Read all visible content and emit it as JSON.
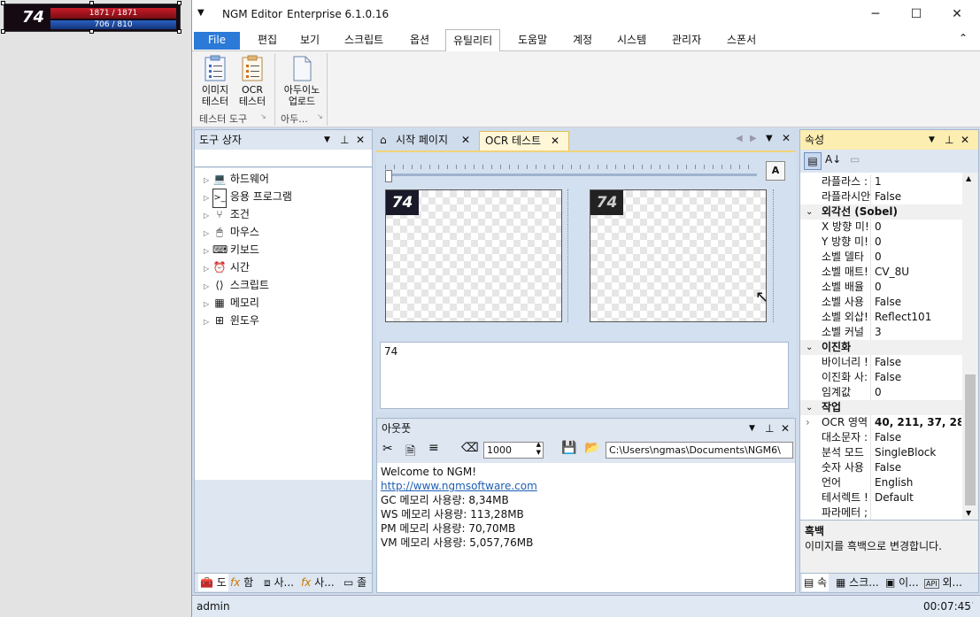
{
  "capture": {
    "level": "74",
    "hp": "1871 / 1871",
    "mp": "706 / 810"
  },
  "window": {
    "app_name": "NGM Editor",
    "edition": "Enterprise 6.1.0.16",
    "menu_glyph": "▼",
    "minimize": "─",
    "maximize": "☐",
    "close": "✕"
  },
  "menu": {
    "file": "File",
    "items": [
      "편집",
      "보기",
      "스크립트",
      "옵션",
      "유틸리티",
      "도움말",
      "계정",
      "시스템",
      "관리자",
      "스폰서"
    ],
    "active_index": 4,
    "collapse": "⌃"
  },
  "ribbon": {
    "buttons": [
      {
        "line1": "이미지",
        "line2": "테스터"
      },
      {
        "line1": "OCR",
        "line2": "테스터"
      },
      {
        "line1": "아두이노",
        "line2": "업로드"
      }
    ],
    "groups": [
      "테스터 도구",
      "아두..."
    ]
  },
  "toolbox": {
    "title": "도구 상자",
    "items": [
      "하드웨어",
      "응용 프로그램",
      "조건",
      "마우스",
      "키보드",
      "시간",
      "스크립트",
      "메모리",
      "윈도우"
    ],
    "bottom_tabs": [
      "도",
      "함",
      "사...",
      "사...",
      "졸"
    ]
  },
  "editor": {
    "tabs": [
      "시작 페이지",
      "OCR 테스트"
    ],
    "active_tab": 1,
    "image_level": "74",
    "ocr_result": "74"
  },
  "output": {
    "title": "아웃풋",
    "line_count": "1000",
    "path": "C:\\Users\\ngmas\\Documents\\NGM6\\",
    "lines": [
      "Welcome to NGM!",
      "http://www.ngmsoftware.com",
      "GC 메모리 사용량: 8,34MB",
      "WS 메모리 사용량: 113,28MB",
      "PM 메모리 사용량: 70,70MB",
      "VM 메모리 사용량: 5,057,76MB"
    ]
  },
  "properties": {
    "title": "속성",
    "rows": [
      {
        "type": "prop",
        "name": "라플라스 :",
        "value": "1"
      },
      {
        "type": "prop",
        "name": "라플라시안",
        "value": "False"
      },
      {
        "type": "cat",
        "name": "외각선 (Sobel)"
      },
      {
        "type": "prop",
        "name": "X 방향 미!",
        "value": "0"
      },
      {
        "type": "prop",
        "name": "Y 방향 미!",
        "value": "0"
      },
      {
        "type": "prop",
        "name": "소벨 델타",
        "value": "0"
      },
      {
        "type": "prop",
        "name": "소벨 매트!",
        "value": "CV_8U"
      },
      {
        "type": "prop",
        "name": "소벨 배율",
        "value": "0"
      },
      {
        "type": "prop",
        "name": "소벨 사용",
        "value": "False"
      },
      {
        "type": "prop",
        "name": "소벨 외삽!",
        "value": "Reflect101"
      },
      {
        "type": "prop",
        "name": "소벨 커널",
        "value": "3"
      },
      {
        "type": "cat",
        "name": "이진화"
      },
      {
        "type": "prop",
        "name": "바이너리 !",
        "value": "False"
      },
      {
        "type": "prop",
        "name": "이진화 사:",
        "value": "False"
      },
      {
        "type": "prop",
        "name": "임계값",
        "value": "0"
      },
      {
        "type": "cat",
        "name": "작업"
      },
      {
        "type": "prop",
        "name": "OCR 영역",
        "value": "40, 211, 37, 28",
        "bold": true,
        "expand": true
      },
      {
        "type": "prop",
        "name": "대소문자 :",
        "value": "False"
      },
      {
        "type": "prop",
        "name": "분석 모드",
        "value": "SingleBlock"
      },
      {
        "type": "prop",
        "name": "숫자 사용",
        "value": "False"
      },
      {
        "type": "prop",
        "name": "언어",
        "value": "English"
      },
      {
        "type": "prop",
        "name": "테서렉트 !",
        "value": "Default"
      },
      {
        "type": "prop",
        "name": "파라메터 ;",
        "value": ""
      }
    ],
    "desc_title": "흑백",
    "desc_text": "이미지를 흑백으로 변경합니다.",
    "bottom_tabs": [
      "속",
      "스크...",
      "이...",
      "외..."
    ]
  },
  "status": {
    "user": "admin",
    "time": "00:07:45"
  }
}
